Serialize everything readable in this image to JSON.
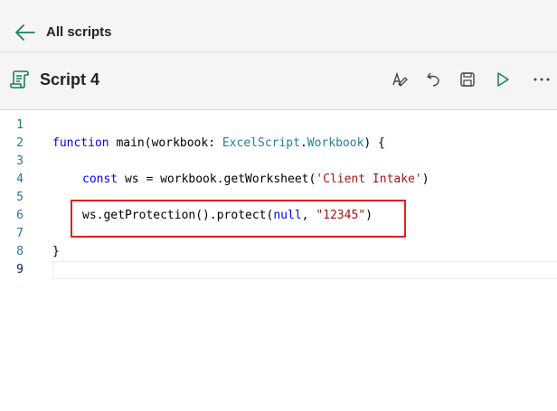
{
  "nav": {
    "back_label": "All scripts"
  },
  "script": {
    "title": "Script 4"
  },
  "toolbar": {
    "items": [
      {
        "name": "rename-icon"
      },
      {
        "name": "undo-icon"
      },
      {
        "name": "save-icon"
      },
      {
        "name": "run-icon"
      },
      {
        "name": "more-options-icon"
      }
    ]
  },
  "editor": {
    "line_numbers": [
      "1",
      "2",
      "3",
      "4",
      "5",
      "6",
      "7",
      "8",
      "9"
    ],
    "lines": {
      "l2": {
        "kw": "function",
        "sp1": " ",
        "fn": "main",
        "p1": "(workbook: ",
        "ty1": "ExcelScript",
        "dot": ".",
        "ty2": "Workbook",
        "p2": ") {"
      },
      "l4": {
        "kw": "const",
        "p1": " ws = workbook.",
        "fn": "getWorksheet",
        "p2": "(",
        "str": "'Client Intake'",
        "p3": ")"
      },
      "l6": {
        "p1": "ws.",
        "fn1": "getProtection",
        "p2": "().",
        "fn2": "protect",
        "p3": "(",
        "kw": "null",
        "p4": ", ",
        "str": "\"12345\"",
        "p5": ")"
      },
      "l8": {
        "p1": "}"
      }
    }
  },
  "colors": {
    "keyword": "#0000ff",
    "function": "#795e26",
    "type": "#267f99",
    "string": "#a31515",
    "highlight": "#e02020"
  }
}
